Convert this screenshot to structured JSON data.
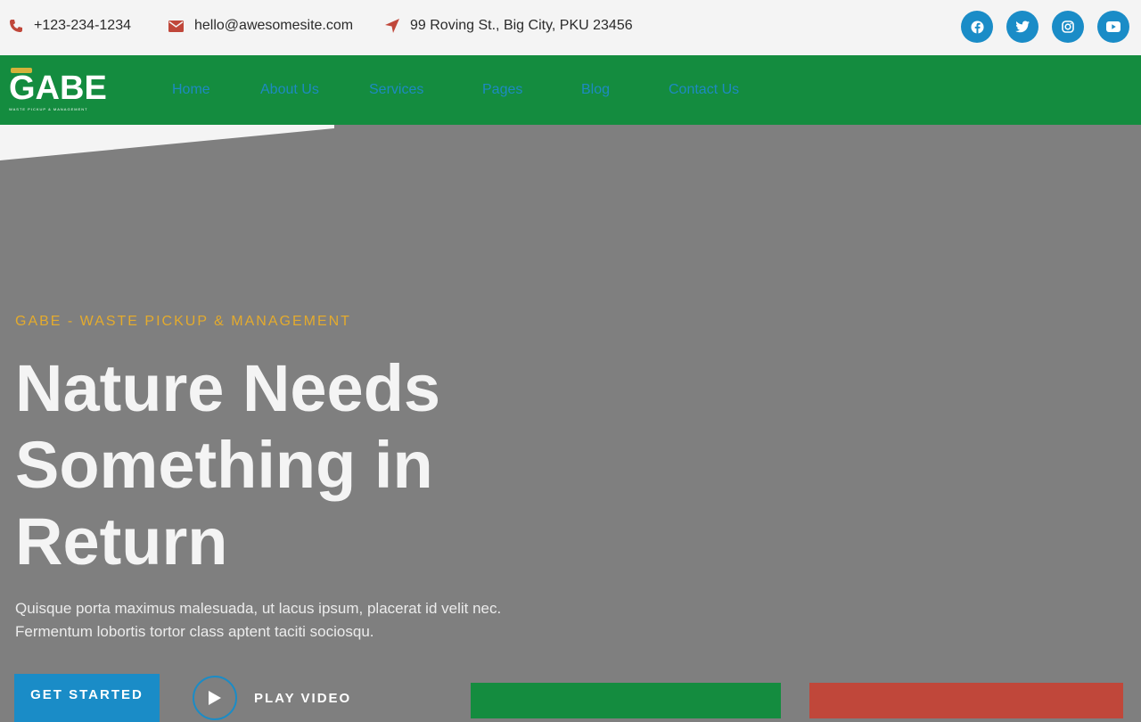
{
  "topbar": {
    "phone": "+123-234-1234",
    "email": "hello@awesomesite.com",
    "address": "99 Roving St., Big City, PKU 23456",
    "socials": [
      {
        "icon": "facebook-icon"
      },
      {
        "icon": "twitter-icon"
      },
      {
        "icon": "instagram-icon"
      },
      {
        "icon": "youtube-icon"
      }
    ]
  },
  "logo": {
    "name": "GABE",
    "tagline": "WASTE PICKUP & MANAGEMENT"
  },
  "nav": {
    "items": [
      "Home",
      "About Us",
      "Services",
      "Pages",
      "Blog",
      "Contact Us"
    ]
  },
  "hero": {
    "eyebrow": "GABE - WASTE PICKUP & MANAGEMENT",
    "title_line1": "Nature Needs",
    "title_line2": "Something in",
    "title_line3": "Return",
    "description_line1": "Quisque porta maximus malesuada, ut lacus ipsum, placerat id velit nec.",
    "description_line2": "Fermentum lobortis tortor class aptent taciti sociosqu.",
    "cta_label": "GET STARTED",
    "video_label": "PLAY VIDEO"
  },
  "colors": {
    "topbar_bg": "#f4f4f4",
    "nav_bg": "#148c3f",
    "accent_blue": "#1a8cc7",
    "accent_yellow": "#e4ab2d",
    "accent_red": "#c0473a",
    "hero_overlay": "#7f7f7f"
  }
}
